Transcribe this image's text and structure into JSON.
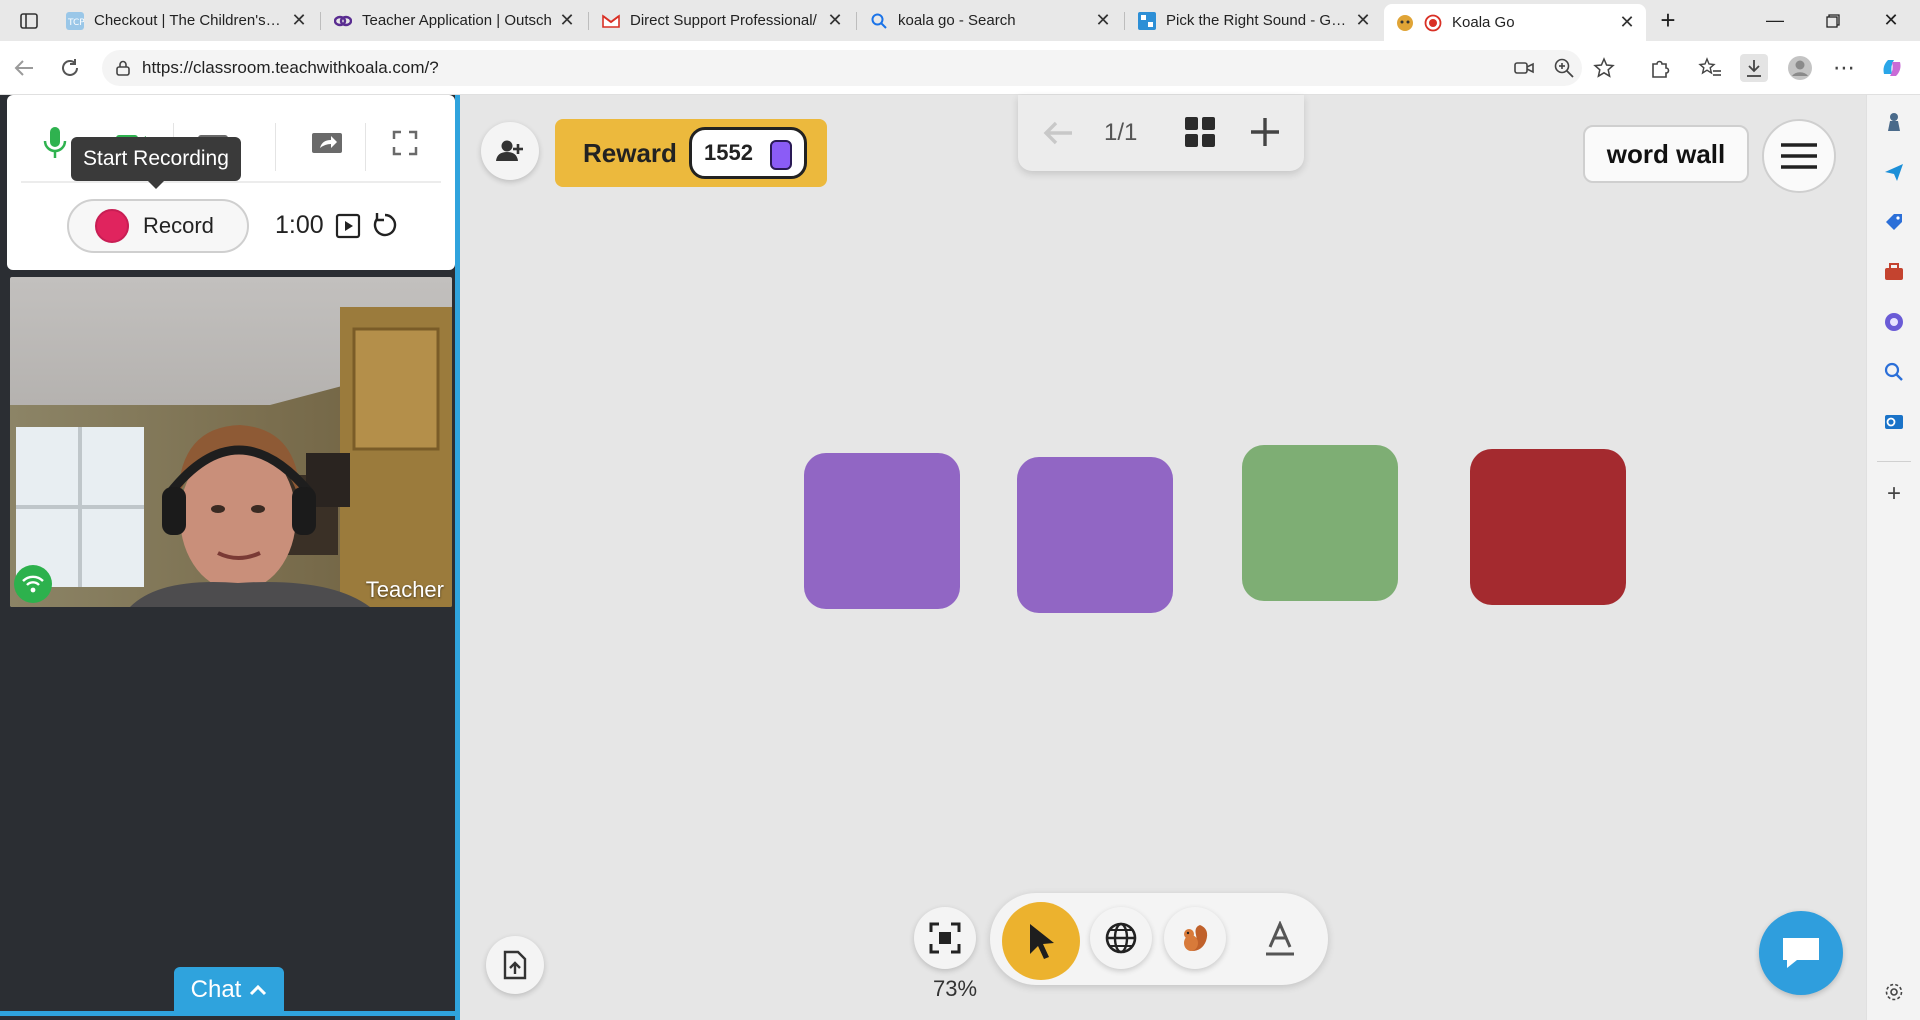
{
  "browser": {
    "tabs": [
      {
        "title": "Checkout | The Children's Pla",
        "favicon": "tcp-icon"
      },
      {
        "title": "Teacher Application | Outsch",
        "favicon": "outschool-icon"
      },
      {
        "title": "Direct Support Professional/",
        "favicon": "gmail-icon"
      },
      {
        "title": "koala go - Search",
        "favicon": "search-icon"
      },
      {
        "title": "Pick the Right Sound - Game",
        "favicon": "game-icon"
      },
      {
        "title": "Koala Go",
        "favicon": "koala-icon",
        "active": true
      }
    ],
    "url": "https://classroom.teachwithkoala.com/?"
  },
  "recording": {
    "tooltip": "Start Recording",
    "record_label": "Record",
    "timer": "1:00"
  },
  "video": {
    "participant_label": "Teacher"
  },
  "chat": {
    "label": "Chat"
  },
  "toolbar": {
    "reward_label": "Reward",
    "reward_count": "1552",
    "page_indicator": "1/1",
    "word_wall_label": "word wall",
    "zoom_level": "73%"
  },
  "colors": {
    "accent_blue": "#2fa3dd",
    "reward_yellow": "#ecb93d",
    "record_red": "#e0245e",
    "tile_purple": "#9166c4",
    "tile_green": "#7eae74",
    "tile_red": "#a42a2f"
  }
}
